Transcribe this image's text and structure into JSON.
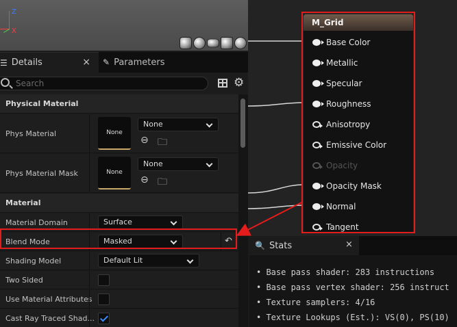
{
  "viewport": {
    "axis_z": "Z",
    "axis_x": "X"
  },
  "details": {
    "tab_details": "Details",
    "tab_parameters": "Parameters",
    "close_symbol": "×",
    "search": {
      "placeholder": "Search"
    },
    "sections": [
      {
        "title": "Physical Material",
        "rows": [
          {
            "label": "Phys Material",
            "thumb": "None",
            "value": "None"
          },
          {
            "label": "Phys Material Mask",
            "thumb": "None",
            "value": "None"
          }
        ]
      },
      {
        "title": "Material",
        "rows": [
          {
            "label": "Material Domain",
            "value": "Surface"
          },
          {
            "label": "Blend Mode",
            "value": "Masked"
          },
          {
            "label": "Shading Model",
            "value": "Default Lit"
          },
          {
            "label": "Two Sided",
            "checked": false
          },
          {
            "label": "Use Material Attributes",
            "checked": false
          },
          {
            "label": "Cast Ray Traced Shad...",
            "checked": true
          }
        ]
      }
    ]
  },
  "node": {
    "title": "M_Grid",
    "pins": [
      {
        "label": "Base Color",
        "connected": true,
        "enabled": true
      },
      {
        "label": "Metallic",
        "connected": true,
        "enabled": true
      },
      {
        "label": "Specular",
        "connected": true,
        "enabled": true
      },
      {
        "label": "Roughness",
        "connected": true,
        "enabled": true
      },
      {
        "label": "Anisotropy",
        "connected": false,
        "enabled": true
      },
      {
        "label": "Emissive Color",
        "connected": false,
        "enabled": true
      },
      {
        "label": "Opacity",
        "connected": false,
        "enabled": false
      },
      {
        "label": "Opacity Mask",
        "connected": true,
        "enabled": true
      },
      {
        "label": "Normal",
        "connected": true,
        "enabled": true
      },
      {
        "label": "Tangent",
        "connected": false,
        "enabled": true
      }
    ]
  },
  "stats": {
    "tab_label": "Stats",
    "close_symbol": "×",
    "lines": [
      "Base pass shader: 283 instructions",
      "Base pass vertex shader: 256 instruct",
      "Texture samplers: 4/16",
      "Texture Lookups (Est.): VS(0), PS(10)"
    ]
  },
  "colors": {
    "highlight": "#e41c1c",
    "check_accent": "#3d8eff",
    "node_header": "#6f5b4b"
  }
}
